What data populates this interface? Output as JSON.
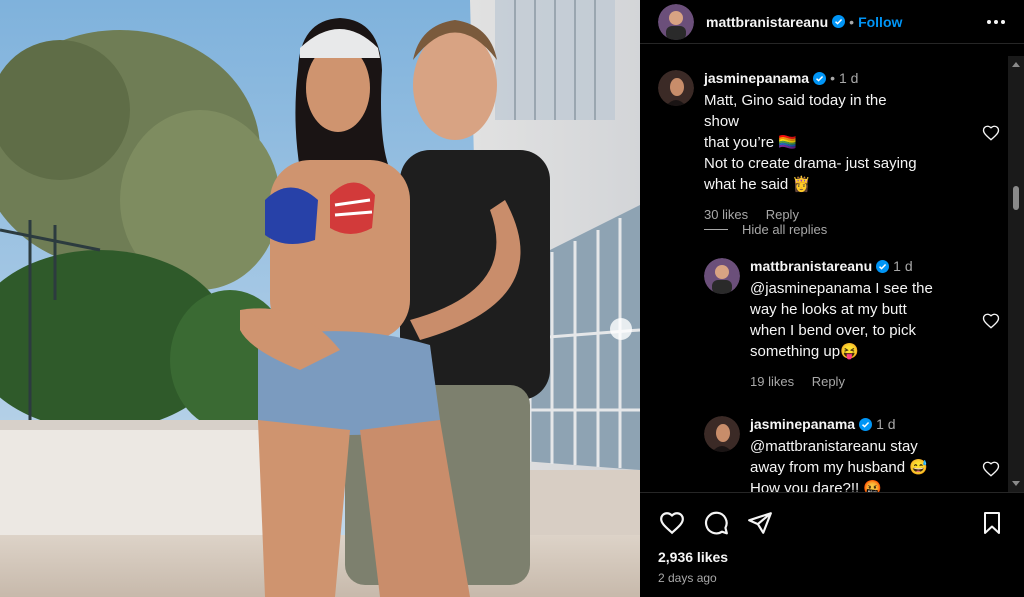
{
  "post": {
    "username": "mattbranistareanu",
    "follow_label": "Follow",
    "separator": "•",
    "likes": "2,936 likes",
    "time_ago": "2 days ago"
  },
  "comments": [
    {
      "username": "jasminepanama",
      "time": "1 d",
      "lines": [
        "Matt, Gino said today in the show",
        "that you’re 🏳️‍🌈",
        "Not to create drama- just saying",
        "what he said 👸"
      ],
      "likes": "30 likes",
      "reply_label": "Reply"
    }
  ],
  "hide_replies_label": "Hide all replies",
  "replies": [
    {
      "username": "mattbranistareanu",
      "time": "1 d",
      "lines": [
        "@jasminepanama I see the",
        "way he looks at my butt",
        "when I bend over, to pick",
        "something up😝"
      ],
      "likes": "19 likes",
      "reply_label": "Reply"
    },
    {
      "username": "jasminepanama",
      "time": "1 d",
      "lines": [
        "@mattbranistareanu stay",
        "away from my husband 😅",
        "How you dare?!! 🤬"
      ]
    }
  ],
  "icons": {
    "more": "more-options-icon",
    "like": "heart-icon",
    "comment": "comment-bubble-icon",
    "share": "paper-plane-icon",
    "save": "bookmark-icon",
    "verified": "verified-badge-icon"
  },
  "colors": {
    "follow": "#0095f6",
    "verified": "#0095f6",
    "background": "#000000",
    "muted": "#a8a8a8"
  }
}
